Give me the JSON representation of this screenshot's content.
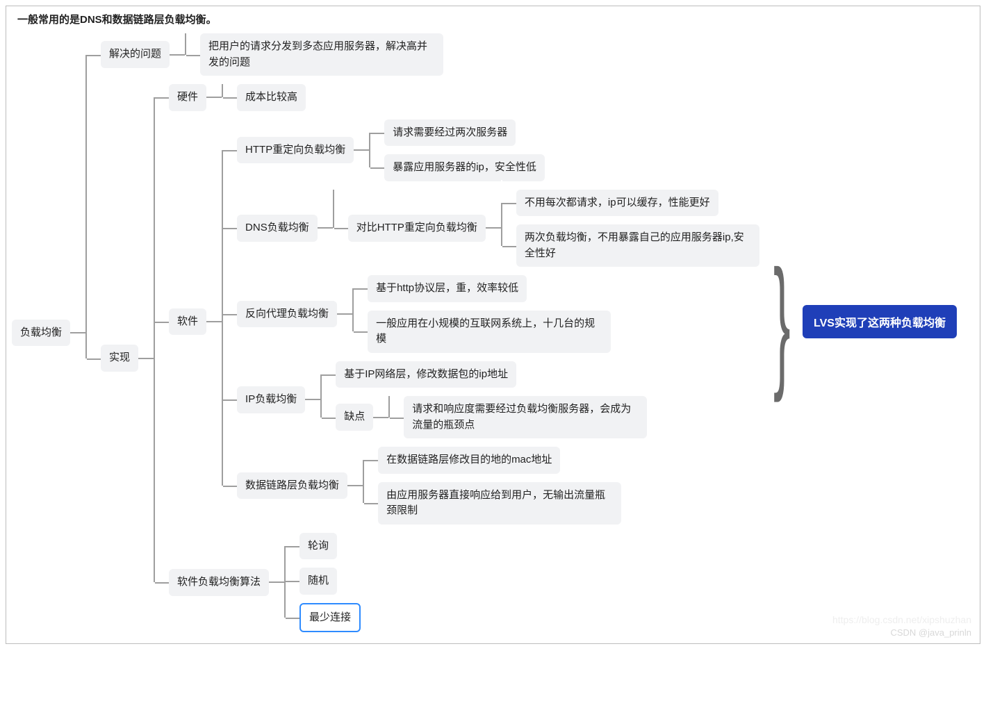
{
  "heading": "一般常用的是DNS和数据链路层负载均衡。",
  "root": "负载均衡",
  "solve_problem": {
    "label": "解决的问题",
    "desc": "把用户的请求分发到多态应用服务器，解决高并发的问题"
  },
  "impl": {
    "label": "实现",
    "hardware": {
      "label": "硬件",
      "desc": "成本比较高"
    },
    "software": {
      "label": "软件",
      "http_redirect": {
        "label": "HTTP重定向负载均衡",
        "p1": "请求需要经过两次服务器",
        "p2": "暴露应用服务器的ip，安全性低"
      },
      "dns": {
        "label": "DNS负载均衡",
        "compare_label": "对比HTTP重定向负载均衡",
        "p1": "不用每次都请求，ip可以缓存，性能更好",
        "p2": "两次负载均衡，不用暴露自己的应用服务器ip,安全性好"
      },
      "reverse_proxy": {
        "label": "反向代理负载均衡",
        "p1": "基于http协议层，重，效率较低",
        "p2": "一般应用在小规模的互联网系统上，十几台的规模"
      },
      "ip": {
        "label": "IP负载均衡",
        "p1": "基于IP网络层，修改数据包的ip地址",
        "drawback_label": "缺点",
        "drawback_desc": "请求和响应度需要经过负载均衡服务器，会成为流量的瓶颈点"
      },
      "datalink": {
        "label": "数据链路层负载均衡",
        "p1": "在数据链路层修改目的地的mac地址",
        "p2": "由应用服务器直接响应给到用户，无输出流量瓶颈限制"
      }
    },
    "algo": {
      "label": "软件负载均衡算法",
      "items": [
        "轮询",
        "随机",
        "最少连接"
      ]
    }
  },
  "callout": "LVS实现了这两种负载均衡",
  "watermark_faint": "https://blog.csdn.net/xipshuzhan",
  "watermark": "CSDN @java_prinln"
}
